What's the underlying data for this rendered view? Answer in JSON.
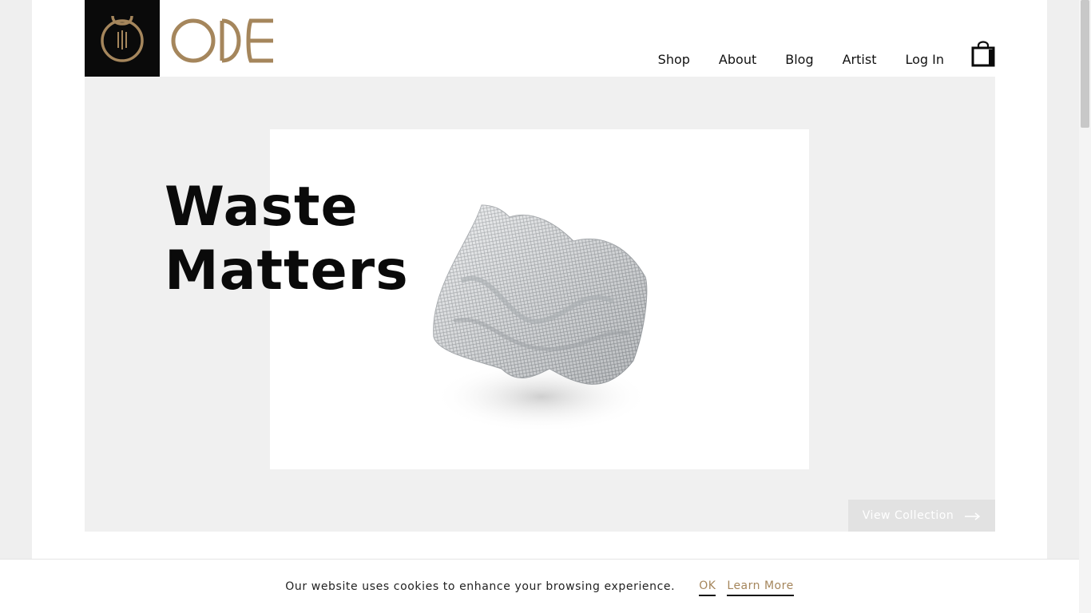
{
  "brand": {
    "name": "ODE",
    "accent_color": "#a5865c",
    "logo_bg": "#0a0a0a"
  },
  "nav": {
    "items": [
      {
        "label": "Shop"
      },
      {
        "label": "About"
      },
      {
        "label": "Blog"
      },
      {
        "label": "Artist"
      },
      {
        "label": "Log In"
      }
    ],
    "cart_icon": "shopping-bag-icon"
  },
  "hero": {
    "title_line1": "Waste",
    "title_line2": "Matters",
    "cta_label": "View Collection",
    "cta_icon": "arrow-right-icon"
  },
  "cookie_banner": {
    "message": "Our website uses cookies to enhance your browsing experience.",
    "ok_label": "OK",
    "learn_more_label": "Learn More"
  }
}
